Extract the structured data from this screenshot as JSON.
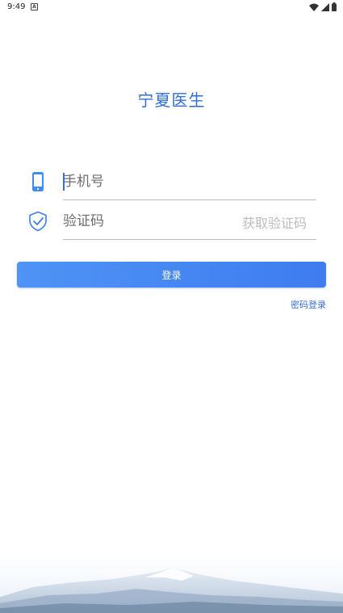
{
  "status_bar": {
    "time": "9:49",
    "notification_letter": "A"
  },
  "app": {
    "title": "宁夏医生"
  },
  "form": {
    "phone_placeholder": "手机号",
    "code_placeholder": "验证码",
    "get_code_label": "获取验证码"
  },
  "actions": {
    "login_label": "登录",
    "password_login_label": "密码登录"
  },
  "colors": {
    "accent": "#2f6ed8",
    "button_start": "#4f93f5",
    "button_end": "#3e7cf0"
  },
  "icons": {
    "phone": "phone-icon",
    "shield": "shield-check-icon",
    "wifi": "wifi-icon",
    "signal": "signal-icon",
    "battery": "battery-icon"
  }
}
